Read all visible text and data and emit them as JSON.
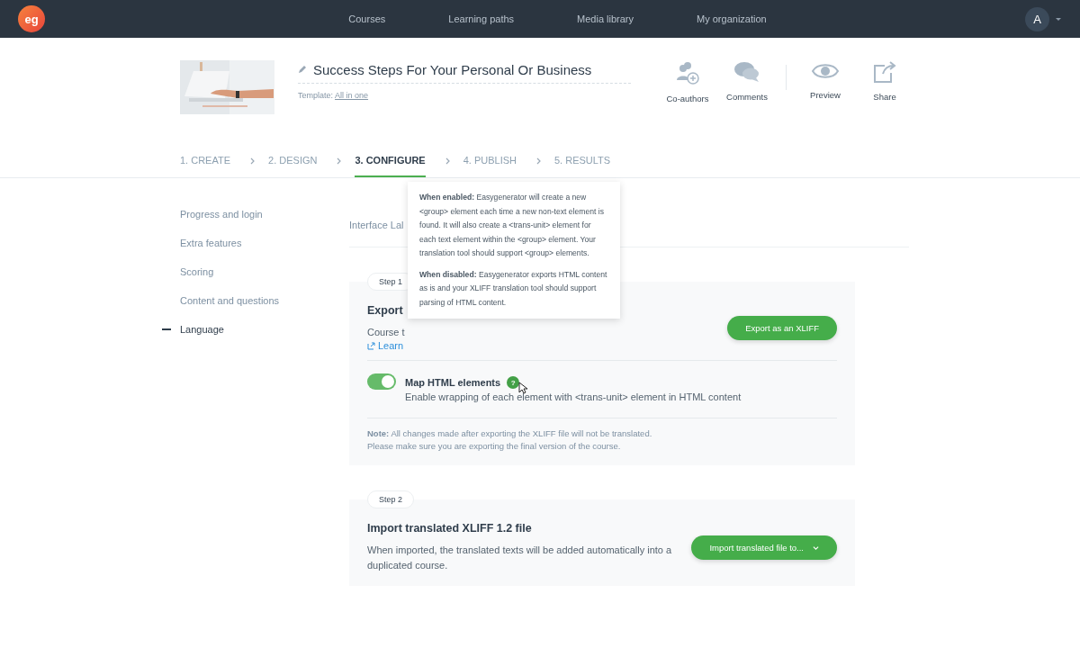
{
  "nav": {
    "logo": "eg",
    "links": [
      "Courses",
      "Learning paths",
      "Media library",
      "My organization"
    ],
    "avatar": "A"
  },
  "course": {
    "title": "Success Steps For Your Personal Or Business",
    "template_label": "Template:",
    "template": "All in one"
  },
  "actions": [
    {
      "kind": "coauthors",
      "label": "Co-authors"
    },
    {
      "kind": "comments",
      "label": "Comments"
    },
    {
      "kind": "preview",
      "label": "Preview"
    },
    {
      "kind": "share",
      "label": "Share"
    }
  ],
  "steps": [
    {
      "label": "1. CREATE",
      "selected": false
    },
    {
      "label": "2. DESIGN",
      "selected": false
    },
    {
      "label": "3. CONFIGURE",
      "selected": true
    },
    {
      "label": "4. PUBLISH",
      "selected": false
    },
    {
      "label": "5. RESULTS",
      "selected": false
    }
  ],
  "sidebar": [
    {
      "label": "Progress and login",
      "selected": false
    },
    {
      "label": "Extra features",
      "selected": false
    },
    {
      "label": "Scoring",
      "selected": false
    },
    {
      "label": "Content and questions",
      "selected": false
    },
    {
      "label": "Language",
      "selected": true
    }
  ],
  "subtabs": [
    "Interface Lal"
  ],
  "step1": {
    "badge": "Step 1",
    "title": "Export",
    "text": "Course t",
    "link": "Learn",
    "button": "Export as an XLIFF",
    "option": {
      "label": "Map HTML elements",
      "on": true,
      "help": "?",
      "description": "Enable wrapping of each element with <trans-unit> element in HTML content"
    },
    "note": [
      "**Note:** All changes made after exporting the XLIFF file will not be translated.",
      "Please make sure you are exporting the final version of the course."
    ]
  },
  "tooltip": [
    "**When enabled:** Easygenerator will create a new <group> element each time a new non-text element is found. It will also create a <trans-unit> element for each text element within the <group> element. Your translation tool should support <group> elements.",
    "**When disabled:** Easygenerator exports HTML content as is and your XLIFF translation tool should support parsing of HTML content."
  ],
  "step2": {
    "badge": "Step 2",
    "title": "Import translated XLIFF 1.2 file",
    "text": "When imported, the translated texts will be added automatically into a duplicated course.",
    "button": "Import translated file to..."
  }
}
